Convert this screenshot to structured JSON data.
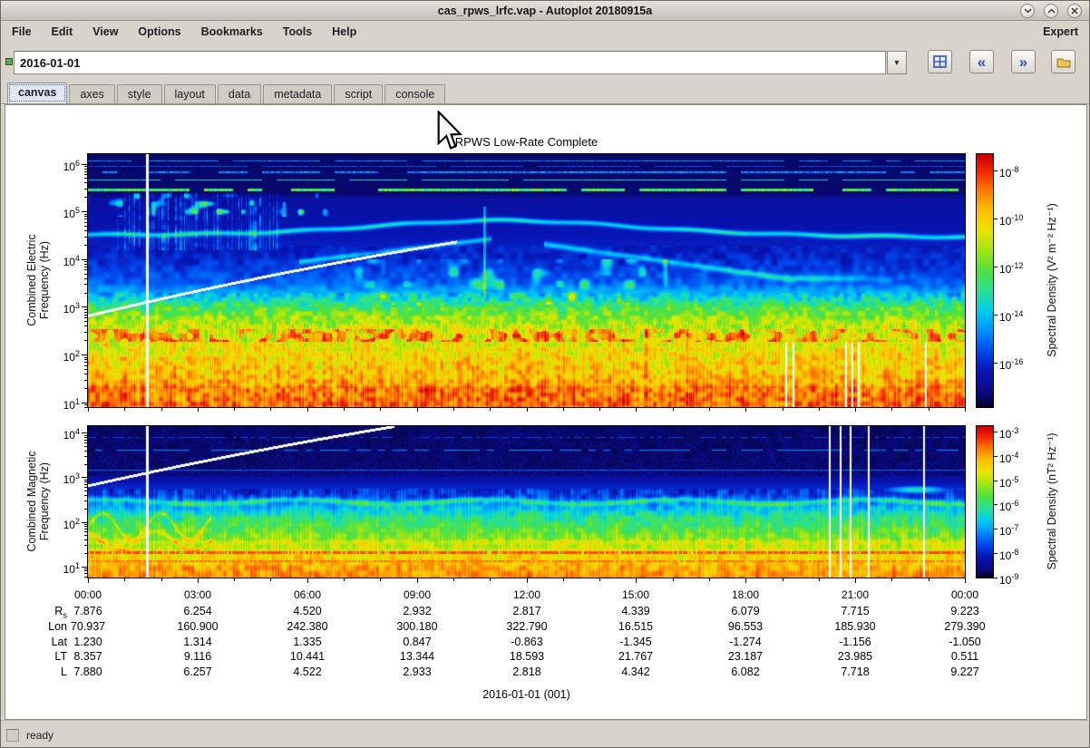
{
  "window": {
    "title": "cas_rpws_lrfc.vap - Autoplot 20180915a",
    "controls": [
      {
        "name": "minimize"
      },
      {
        "name": "maximize"
      },
      {
        "name": "close"
      }
    ]
  },
  "menu_bar": {
    "items": [
      "File",
      "Edit",
      "View",
      "Options",
      "Bookmarks",
      "Tools",
      "Help"
    ],
    "mode_label": "Expert"
  },
  "uri_bar": {
    "value": "2016-01-01",
    "dropdown_glyph": "▼",
    "buttons": [
      {
        "name": "grid",
        "icon": "grid-icon"
      },
      {
        "name": "previous-interval",
        "icon": "double-left-arrow-icon",
        "glyph": "«"
      },
      {
        "name": "next-interval",
        "icon": "double-right-arrow-icon",
        "glyph": "»"
      },
      {
        "name": "open-file",
        "icon": "folder-icon"
      }
    ]
  },
  "tabs": {
    "selected": "canvas",
    "items": [
      "canvas",
      "axes",
      "style",
      "layout",
      "data",
      "metadata",
      "script",
      "console"
    ]
  },
  "status_bar": {
    "text": "ready"
  },
  "plot": {
    "title": "RPWS Low-Rate Complete",
    "x_axis_label": "2016-01-01 (001)",
    "time_ticks": [
      "00:00",
      "03:00",
      "06:00",
      "09:00",
      "12:00",
      "15:00",
      "18:00",
      "21:00",
      "00:00"
    ]
  },
  "chart_data": [
    {
      "type": "heatmap",
      "panel": "electric-spectrogram",
      "title": "RPWS Low-Rate Complete",
      "ylabel_lines": [
        "Combined Electric",
        "Frequency (Hz)"
      ],
      "y_scale": "log",
      "y_tick_exponents": [
        1,
        2,
        3,
        4,
        5,
        6
      ],
      "ylim_log10": [
        0.9,
        6.2
      ],
      "x_tick_labels": [
        "00:00",
        "03:00",
        "06:00",
        "09:00",
        "12:00",
        "15:00",
        "18:00",
        "21:00",
        "00:00"
      ],
      "xlim": [
        "2016-01-01 00:00",
        "2016-01-02 00:00"
      ],
      "grid": false,
      "colorbar": {
        "label": "Spectral Density (V² m⁻² Hz⁻¹)",
        "tick_exponents": [
          -8,
          -10,
          -12,
          -14,
          -16
        ],
        "palette": "rainbow blue-to-red"
      },
      "features": [
        "white vertical data gap near 01:36",
        "white model trace rising from ~700 Hz at 00:00 to ~25 kHz near 10:00",
        "bright cyan upper-hybrid band near 30-80 kHz peaking near 11:30",
        "narrowband interference lines above 200 kHz",
        "broadband red/orange emission below ~300 Hz",
        "white dropout columns near 19:00-21:00 below ~200 Hz"
      ]
    },
    {
      "type": "heatmap",
      "panel": "magnetic-spectrogram",
      "title": "RPWS Low-Rate Complete",
      "ylabel_lines": [
        "Combined Magnetic",
        "Frequency (Hz)"
      ],
      "y_scale": "log",
      "y_tick_exponents": [
        1,
        2,
        3,
        4
      ],
      "ylim_log10": [
        0.75,
        4.15
      ],
      "x_tick_labels": [
        "00:00",
        "03:00",
        "06:00",
        "09:00",
        "12:00",
        "15:00",
        "18:00",
        "21:00",
        "00:00"
      ],
      "xlim": [
        "2016-01-01 00:00",
        "2016-01-02 00:00"
      ],
      "grid": false,
      "colorbar": {
        "label": "Spectral Density (nT² Hz⁻¹)",
        "tick_exponents": [
          -3,
          -4,
          -5,
          -6,
          -7,
          -8,
          -9
        ],
        "palette": "rainbow blue-to-red"
      },
      "features": [
        "white vertical data gap near 01:36",
        "white model trace rising from ~700 Hz, exiting top of panel near 08:00",
        "dark speckled background above ~1 kHz",
        "cyan band near 250-400 Hz",
        "intense red/orange emission below ~30 Hz",
        "white full-height dropout columns near 20:00-23:00"
      ]
    }
  ],
  "ephemeris": {
    "rows": [
      {
        "label": "R",
        "sub": "s",
        "values": [
          "7.876",
          "6.254",
          "4.520",
          "2.932",
          "2.817",
          "4.339",
          "6.079",
          "7.715",
          "9.223"
        ]
      },
      {
        "label": "Lon",
        "sub": "",
        "values": [
          "70.937",
          "160.900",
          "242.380",
          "300.180",
          "322.790",
          "16.515",
          "96.553",
          "185.930",
          "279.390"
        ]
      },
      {
        "label": "Lat",
        "sub": "",
        "values": [
          "1.230",
          "1.314",
          "1.335",
          "0.847",
          "-0.863",
          "-1.345",
          "-1.274",
          "-1.156",
          "-1.050"
        ]
      },
      {
        "label": "LT",
        "sub": "",
        "values": [
          "8.357",
          "9.116",
          "10.441",
          "13.344",
          "18.593",
          "21.767",
          "23.187",
          "23.985",
          "0.511"
        ]
      },
      {
        "label": "L",
        "sub": "",
        "values": [
          "7.880",
          "6.257",
          "4.522",
          "2.933",
          "2.818",
          "4.342",
          "6.082",
          "7.718",
          "9.227"
        ]
      }
    ]
  }
}
